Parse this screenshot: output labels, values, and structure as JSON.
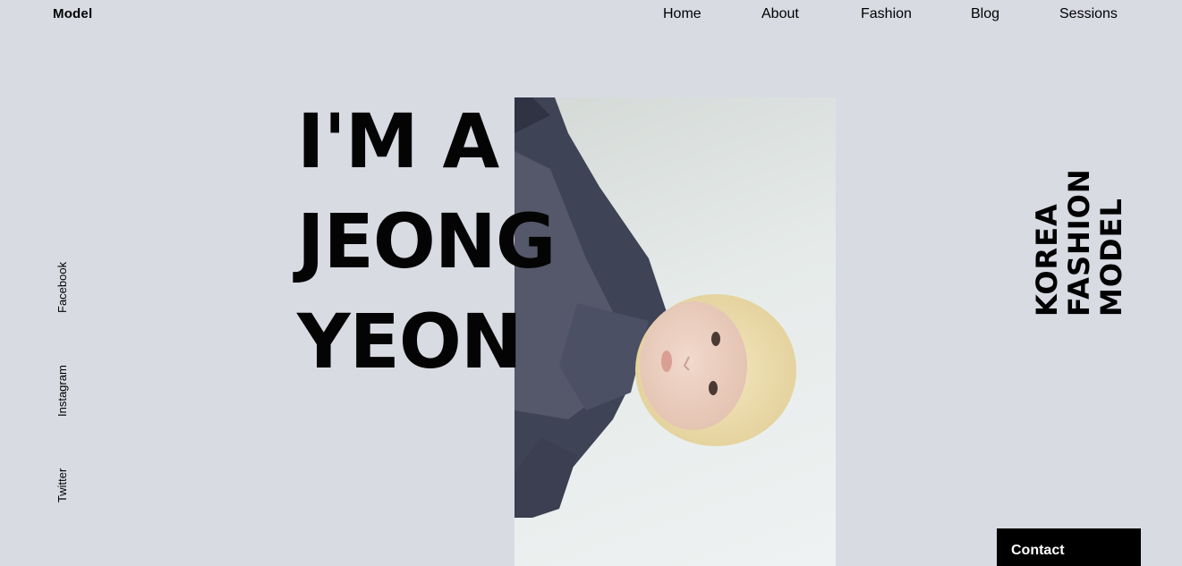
{
  "brand": {
    "logo": "Model"
  },
  "nav": {
    "items": [
      {
        "label": "Home"
      },
      {
        "label": "About"
      },
      {
        "label": "Fashion"
      },
      {
        "label": "Blog"
      },
      {
        "label": "Sessions"
      }
    ]
  },
  "social": {
    "facebook": "Facebook",
    "instagram": "Instagram",
    "twitter": "Twitter"
  },
  "hero": {
    "headline_lines": [
      "I'M A",
      "JEONG",
      "YEON"
    ],
    "vertical_lines": [
      "KOREA",
      "FASHION",
      "MODEL"
    ],
    "photo_icon": "model-portrait-image"
  },
  "cta": {
    "contact_label": "Contact"
  },
  "colors": {
    "background": "#d9dbe3",
    "text": "#000000",
    "contact_bg": "#000000",
    "contact_text": "#ffffff"
  }
}
